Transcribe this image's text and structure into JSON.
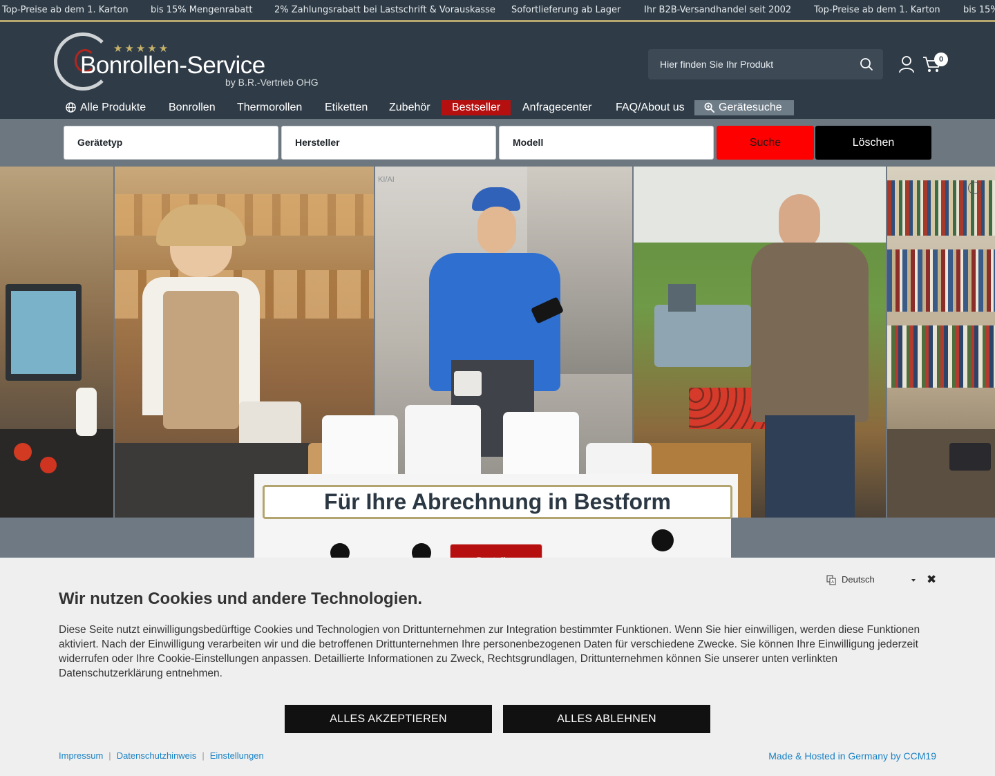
{
  "ticker": {
    "items": [
      "Top-Preise ab dem 1. Karton",
      "bis 15% Mengenrabatt",
      "2% Zahlungsrabatt bei Lastschrift & Vorauskasse",
      "Sofortlieferung ab Lager",
      "Ihr B2B-Versandhandel seit 2002",
      "Top-Preise ab dem 1. Karton",
      "bis 15%"
    ]
  },
  "logo": {
    "name": "Bonrollen-Service",
    "sub": "by B.R.-Vertrieb OHG",
    "stars": "★★★★★"
  },
  "search": {
    "placeholder": "Hier finden Sie Ihr Produkt"
  },
  "cart": {
    "count": "0"
  },
  "nav": {
    "items": [
      {
        "label": "Alle Produkte"
      },
      {
        "label": "Bonrollen"
      },
      {
        "label": "Thermorollen"
      },
      {
        "label": "Etiketten"
      },
      {
        "label": "Zubehör"
      },
      {
        "label": "Bestseller"
      },
      {
        "label": "Anfragecenter"
      },
      {
        "label": "FAQ/About us"
      },
      {
        "label": "Gerätesuche"
      }
    ]
  },
  "device_search": {
    "type": "Gerätetyp",
    "manufacturer": "Hersteller",
    "model": "Modell",
    "search_label": "Suche",
    "clear_label": "Löschen"
  },
  "hero": {
    "ai_tag": "KI/AI",
    "headline": "Für Ihre Abrechnung in Bestform",
    "cta": "Bestellen"
  },
  "cookie": {
    "language": "Deutsch",
    "title": "Wir nutzen Cookies und andere Technologien.",
    "text": "Diese Seite nutzt einwilligungsbedürftige Cookies und Technologien von Drittunternehmen zur Integration bestimmter Funktionen. Wenn Sie hier einwilligen, werden diese Funktionen aktiviert. Nach der Einwilligung verarbeiten wir und die betroffenen Drittunternehmen Ihre personenbezogenen Daten für verschiedene Zwecke. Sie können Ihre Einwilligung jederzeit widerrufen oder Ihre Cookie-Einstellungen anpassen. Detaillierte Informationen zu Zweck, Rechtsgrundlagen, Drittunternehmen können Sie unserer unten verlinkten Datenschutzerklärung entnehmen.",
    "accept": "ALLES AKZEPTIEREN",
    "reject": "ALLES ABLEHNEN",
    "links": [
      "Impressum",
      "Datenschutzhinweis",
      "Einstellungen"
    ],
    "made": "Made & Hosted in Germany by CCM19"
  },
  "colors": {
    "header_bg": "#2f3c47",
    "accent_gold": "#b7a66e",
    "bestseller_red": "#b5100f",
    "search_red": "#ff0000",
    "link_blue": "#1a82c4"
  }
}
